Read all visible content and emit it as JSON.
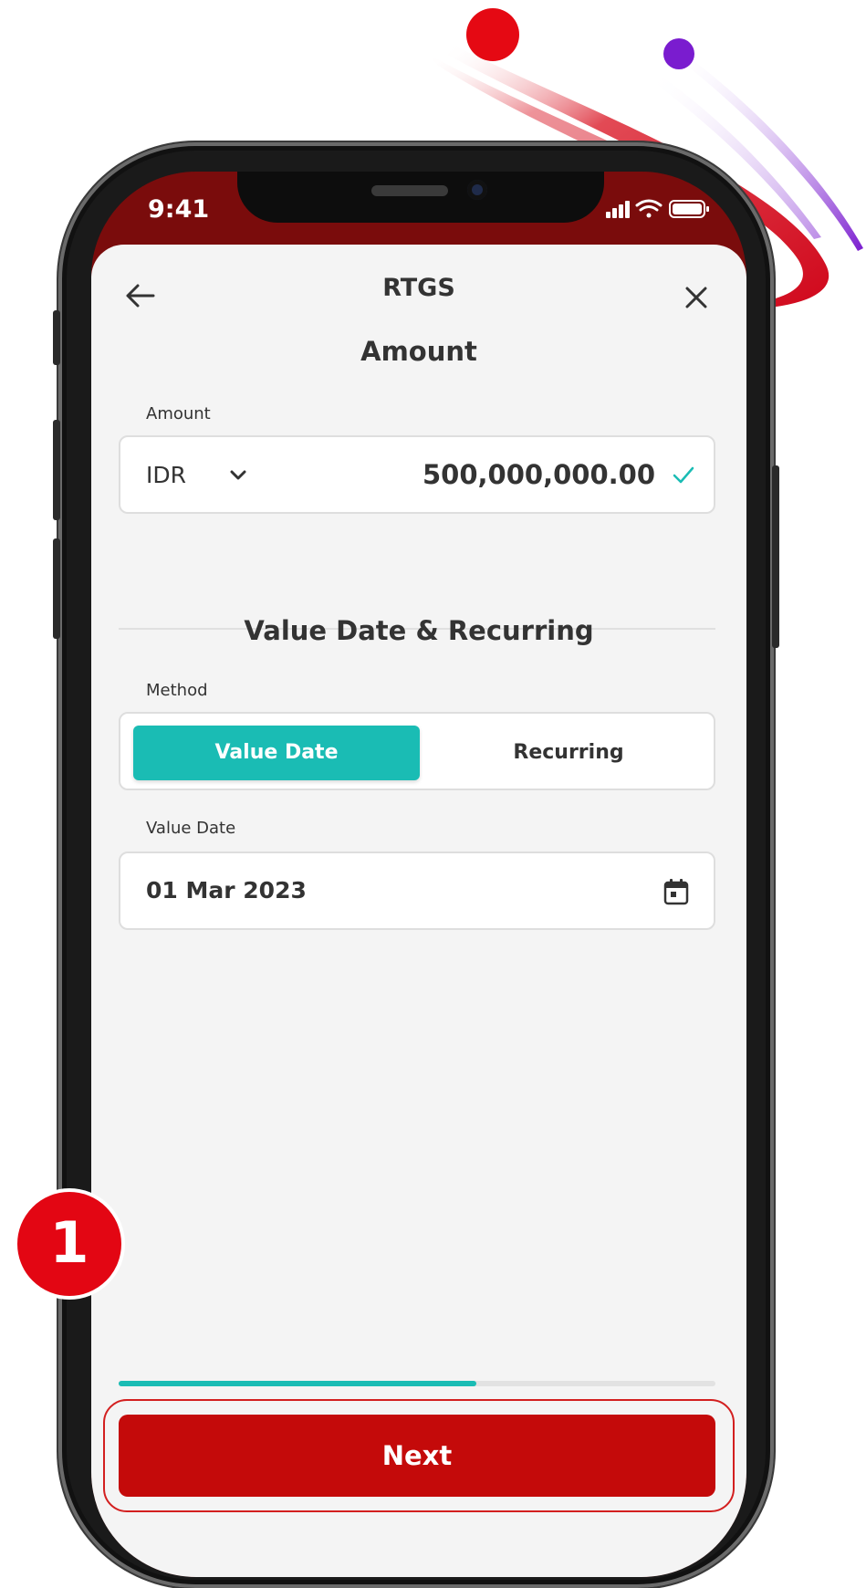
{
  "status_bar": {
    "time": "9:41"
  },
  "header": {
    "title": "RTGS"
  },
  "amount_section": {
    "title": "Amount",
    "field_label": "Amount",
    "currency": "IDR",
    "value": "500,000,000.00"
  },
  "schedule_section": {
    "title": "Value Date & Recurring",
    "method_label": "Method",
    "method_options": [
      "Value Date",
      "Recurring"
    ],
    "selected_method": "Value Date",
    "date_label": "Value Date",
    "date_value": "01 Mar 2023"
  },
  "progress": {
    "fraction": 0.6
  },
  "footer": {
    "next_label": "Next"
  },
  "annotation": {
    "step_number": "1"
  },
  "colors": {
    "accent": "#1abcb4",
    "primary": "#c40a0a",
    "header_bg": "#7a0c0c",
    "badge": "#e30613",
    "decor_purple": "#7a1ccf"
  },
  "icons": [
    "back-arrow-icon",
    "close-icon",
    "chevron-down-icon",
    "check-icon",
    "calendar-icon",
    "signal-icon",
    "wifi-icon",
    "battery-icon"
  ]
}
